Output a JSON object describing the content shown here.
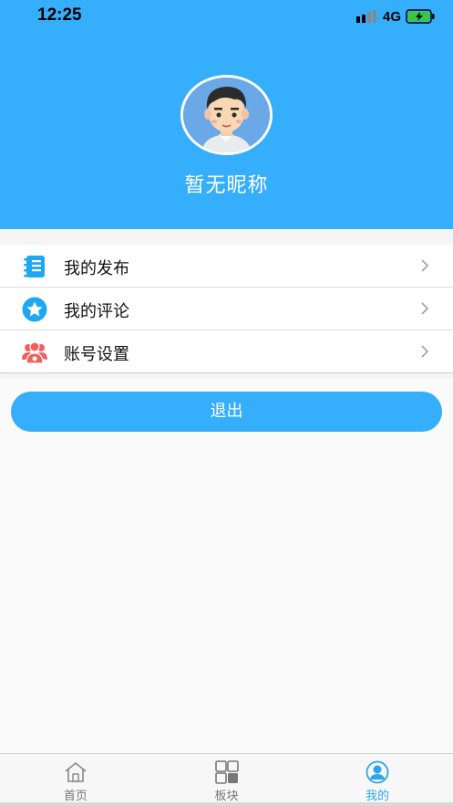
{
  "status_bar": {
    "time": "12:25",
    "network": "4G"
  },
  "profile": {
    "nickname": "暂无昵称"
  },
  "menu": {
    "items": [
      {
        "label": "我的发布",
        "icon": "notebook-icon"
      },
      {
        "label": "我的评论",
        "icon": "star-icon"
      },
      {
        "label": "账号设置",
        "icon": "users-icon"
      }
    ]
  },
  "actions": {
    "logout_label": "退出"
  },
  "tabbar": {
    "tabs": [
      {
        "label": "首页",
        "icon": "home-icon"
      },
      {
        "label": "板块",
        "icon": "grid-icon"
      },
      {
        "label": "我的",
        "icon": "user-icon",
        "active": true
      }
    ]
  },
  "colors": {
    "primary": "#35aefc",
    "star_icon": "#1ea7f3",
    "users_icon": "#f0605d"
  }
}
